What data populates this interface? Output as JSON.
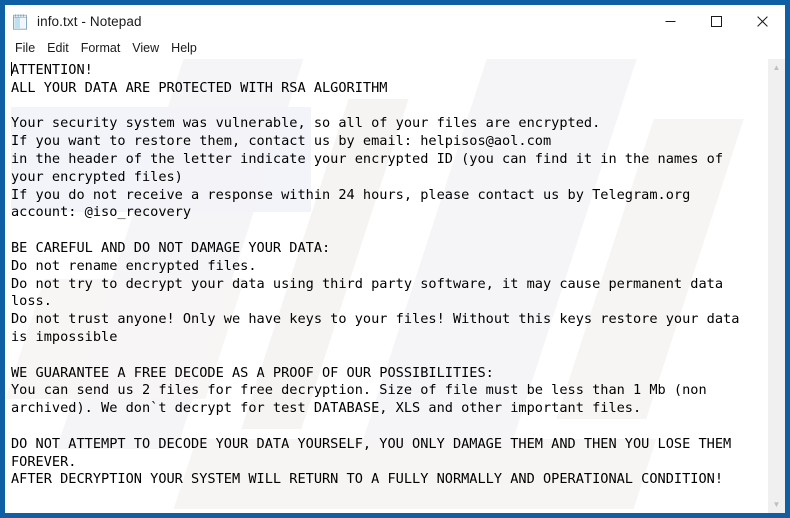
{
  "window": {
    "title": "info.txt - Notepad",
    "icon": "notepad-icon",
    "accent_color": "#0e5fa4",
    "controls": {
      "minimize": "—",
      "maximize": "□",
      "close": "✕"
    }
  },
  "menubar": {
    "items": [
      {
        "label": "File"
      },
      {
        "label": "Edit"
      },
      {
        "label": "Format"
      },
      {
        "label": "View"
      },
      {
        "label": "Help"
      }
    ]
  },
  "scrollbar": {
    "up_arrow": "▲",
    "down_arrow": "▼"
  },
  "document": {
    "filename": "info.txt",
    "body": "ATTENTION!\nALL YOUR DATA ARE PROTECTED WITH RSA ALGORITHM\n\nYour security system was vulnerable, so all of your files are encrypted.\nIf you want to restore them, contact us by email: helpisos@aol.com\nin the header of the letter indicate your encrypted ID (you can find it in the names of\nyour encrypted files)\nIf you do not receive a response within 24 hours, please contact us by Telegram.org\naccount: @iso_recovery\n\nBE CAREFUL AND DO NOT DAMAGE YOUR DATA:\nDo not rename encrypted files.\nDo not try to decrypt your data using third party software, it may cause permanent data\nloss.\nDo not trust anyone! Only we have keys to your files! Without this keys restore your data\nis impossible\n\nWE GUARANTEE A FREE DECODE AS A PROOF OF OUR POSSIBILITIES:\nYou can send us 2 files for free decryption. Size of file must be less than 1 Mb (non\narchived). We don`t decrypt for test DATABASE, XLS and other important files.\n\nDO NOT ATTEMPT TO DECODE YOUR DATA YOURSELF, YOU ONLY DAMAGE THEM AND THEN YOU LOSE THEM\nFOREVER.\nAFTER DECRYPTION YOUR SYSTEM WILL RETURN TO A FULLY NORMALLY AND OPERATIONAL CONDITION!",
    "contact_email": "helpisos@aol.com",
    "telegram_account": "@iso_recovery",
    "telegram_service": "Telegram.org",
    "response_window": "24 hours",
    "free_files": "2",
    "max_file_size": "1 Mb",
    "encryption": "RSA ALGORITHM"
  }
}
